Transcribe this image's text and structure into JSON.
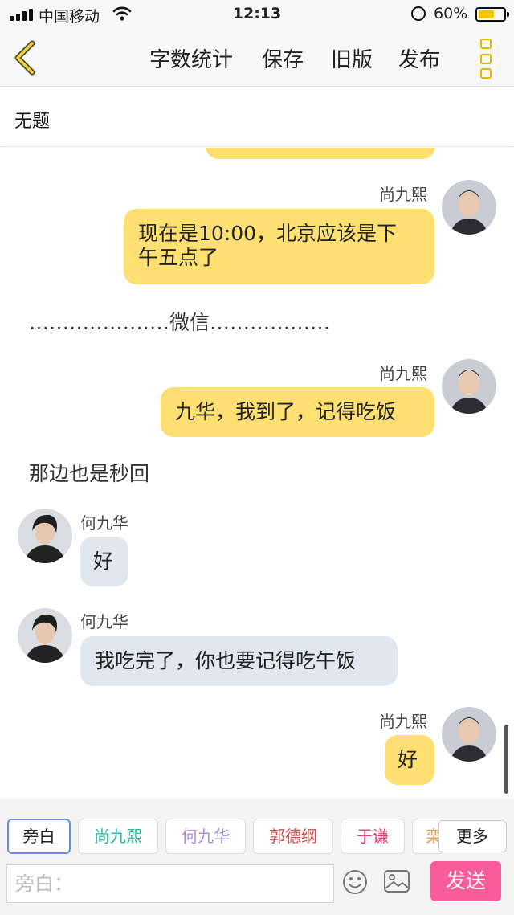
{
  "status_bar": {
    "carrier": "中国移动",
    "time": "12:13",
    "battery": "60%"
  },
  "nav": {
    "word_count": "字数统计",
    "save": "保存",
    "old_version": "旧版",
    "publish": "发布"
  },
  "title": "无题",
  "chat": {
    "messages": [
      {
        "speaker": "尚九熙",
        "text_line1": "现在是10:00，北京应该是下",
        "text_line2": "午五点了"
      },
      {
        "narration": "…………………微信………………"
      },
      {
        "speaker": "尚九熙",
        "text": "九华，我到了，记得吃饭"
      },
      {
        "narration": "那边也是秒回"
      },
      {
        "speaker": "何九华",
        "text": "好"
      },
      {
        "speaker": "何九华",
        "text": "我吃完了，你也要记得吃午饭"
      },
      {
        "speaker": "尚九熙",
        "text": "好"
      }
    ]
  },
  "characters": [
    {
      "label": "旁白",
      "color": "#222222"
    },
    {
      "label": "尚九熙",
      "color": "#2fb8a6"
    },
    {
      "label": "何九华",
      "color": "#a98ad6"
    },
    {
      "label": "郭德纲",
      "color": "#d24b4b"
    },
    {
      "label": "于谦",
      "color": "#e0407a"
    },
    {
      "label": "栾",
      "color": "#e59a4a"
    }
  ],
  "more_label": "更多",
  "input": {
    "placeholder": "旁白："
  },
  "send_label": "发送",
  "colors": {
    "accent_yellow": "#fddf72",
    "left_bubble": "#e1e7ee",
    "send_pink": "#f85c9a",
    "nav_icon": "#e0b800"
  }
}
